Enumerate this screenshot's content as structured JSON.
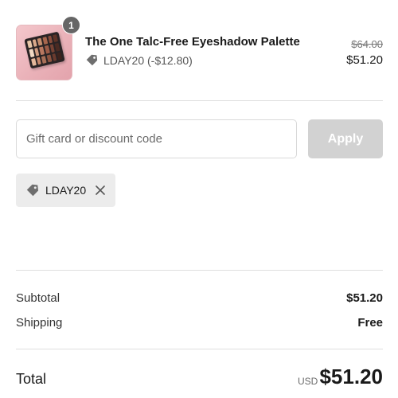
{
  "line_item": {
    "quantity": "1",
    "name": "The One Talc-Free Eyeshadow Palette",
    "discount_text": "LDAY20 (-$12.80)",
    "original_price": "$64.00",
    "current_price": "$51.20",
    "thumbnail_icon": "eyeshadow-palette-image"
  },
  "discount_form": {
    "placeholder": "Gift card or discount code",
    "value": "",
    "apply_label": "Apply"
  },
  "applied_code": {
    "label": "LDAY20",
    "icon": "tag-icon",
    "remove_icon": "close-icon"
  },
  "summary": {
    "subtotal_label": "Subtotal",
    "subtotal_value": "$51.20",
    "shipping_label": "Shipping",
    "shipping_value": "Free",
    "total_label": "Total",
    "total_currency": "USD",
    "total_value": "$51.20"
  },
  "colors": {
    "apply_disabled_bg": "#d2d2d2",
    "chip_bg": "#ececec",
    "badge_bg": "#666666",
    "thumb_bg": "#eab2b9"
  }
}
